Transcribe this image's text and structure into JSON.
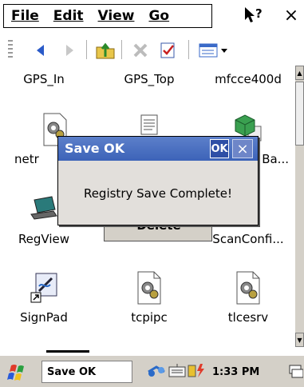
{
  "menubar": {
    "menus": [
      "File",
      "Edit",
      "View",
      "Go"
    ],
    "help_icon": "help-pointer-icon",
    "close_label": "×"
  },
  "toolbar": {
    "buttons": [
      "back-icon",
      "forward-icon",
      "up-folder-icon",
      "delete-icon",
      "properties-icon",
      "views-icon"
    ]
  },
  "files": {
    "row1": [
      "GPS_In",
      "GPS_Top",
      "mfcce400d"
    ],
    "row2": [
      "netr",
      "",
      "Ba..."
    ],
    "row3": [
      "RegView",
      "",
      "ScanConfi..."
    ],
    "row4": [
      "SignPad",
      "tcpipc",
      "tlcesrv"
    ]
  },
  "hidden_button": {
    "label": "Delete"
  },
  "dialog": {
    "title": "Save OK",
    "ok_label": "OK",
    "close_label": "×",
    "message": "Registry Save Complete!"
  },
  "taskbar": {
    "task_label": "Save OK",
    "time": "1:33 PM"
  },
  "colors": {
    "title_bar": "#3c63b8",
    "dialog_bg": "#e2dfdb",
    "taskbar_bg": "#d4d0c8"
  }
}
